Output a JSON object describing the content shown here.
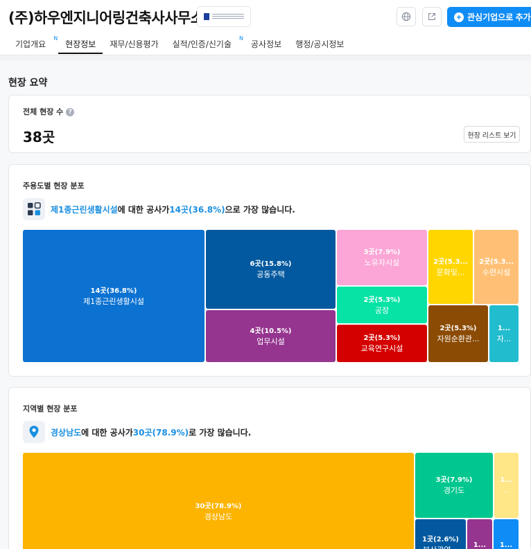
{
  "header": {
    "company_name": "(주)하우엔지니어링건축사사무소",
    "follow_label": "관심기업으로 추가",
    "icons": [
      "globe-icon",
      "external-link-icon",
      "plus-circle-icon"
    ]
  },
  "tabs": [
    {
      "label": "기업개요",
      "badge": "N"
    },
    {
      "label": "현장정보",
      "badge": ""
    },
    {
      "label": "재무/신용평가",
      "badge": ""
    },
    {
      "label": "실적/인증/신기술",
      "badge": "N"
    },
    {
      "label": "공사정보",
      "badge": ""
    },
    {
      "label": "행정/공시정보",
      "badge": ""
    }
  ],
  "section_title": "현장 요약",
  "total": {
    "label": "전체 현장 수",
    "help": "?",
    "count": "38곳",
    "list_button": "현장 리스트 보기"
  },
  "use_distribution": {
    "title": "주용도별 현장 분포",
    "summary_pre": "",
    "summary_highlight1": "제1종근린생활시설",
    "summary_mid": "에 대한 공사가 ",
    "summary_highlight2": "14곳(36.8%)",
    "summary_post": "으로 가장 많습니다.",
    "tiles": [
      {
        "value": "14곳(36.8%)",
        "label": "제1종근린생활시설",
        "color": "#0b72d2"
      },
      {
        "value": "6곳(15.8%)",
        "label": "공동주택",
        "color": "#03599f"
      },
      {
        "value": "4곳(10.5%)",
        "label": "업무시설",
        "color": "#95358f"
      },
      {
        "value": "3곳(7.9%)",
        "label": "노유자시설",
        "color": "#fba6d6"
      },
      {
        "value": "2곳(5.3%)",
        "label": "공장",
        "color": "#07e3a5"
      },
      {
        "value": "2곳(5.3%)",
        "label": "교육연구시설",
        "color": "#d40000"
      },
      {
        "value": "2곳(5.3...",
        "label": "문화및...",
        "color": "#ffd600"
      },
      {
        "value": "2곳(5.3...",
        "label": "수련시설",
        "color": "#ffc075"
      },
      {
        "value": "2곳(5.3%)",
        "label": "자원순환관...",
        "color": "#8b4b04"
      },
      {
        "value": "1...",
        "label": "자...",
        "color": "#22bccf"
      }
    ]
  },
  "region_distribution": {
    "title": "지역별 현장 분포",
    "summary_highlight1": "경상남도",
    "summary_mid": "에 대한 공사가 ",
    "summary_highlight2": "30곳(78.9%)",
    "summary_post": "로 가장 많습니다.",
    "tiles": [
      {
        "value": "30곳(78.9%)",
        "label": "경상남도",
        "color": "#fcb400"
      },
      {
        "value": "3곳(7.9%)",
        "label": "경기도",
        "color": "#00c78f"
      },
      {
        "value": "1...",
        "label": "...",
        "color": "#ffe687"
      },
      {
        "value": "1곳(2.6%)",
        "label": "부산광역...",
        "color": "#03599f"
      },
      {
        "value": "1...",
        "label": "",
        "color": "#95358f"
      },
      {
        "value": "1...",
        "label": "",
        "color": "#0f8cf5"
      }
    ]
  }
}
